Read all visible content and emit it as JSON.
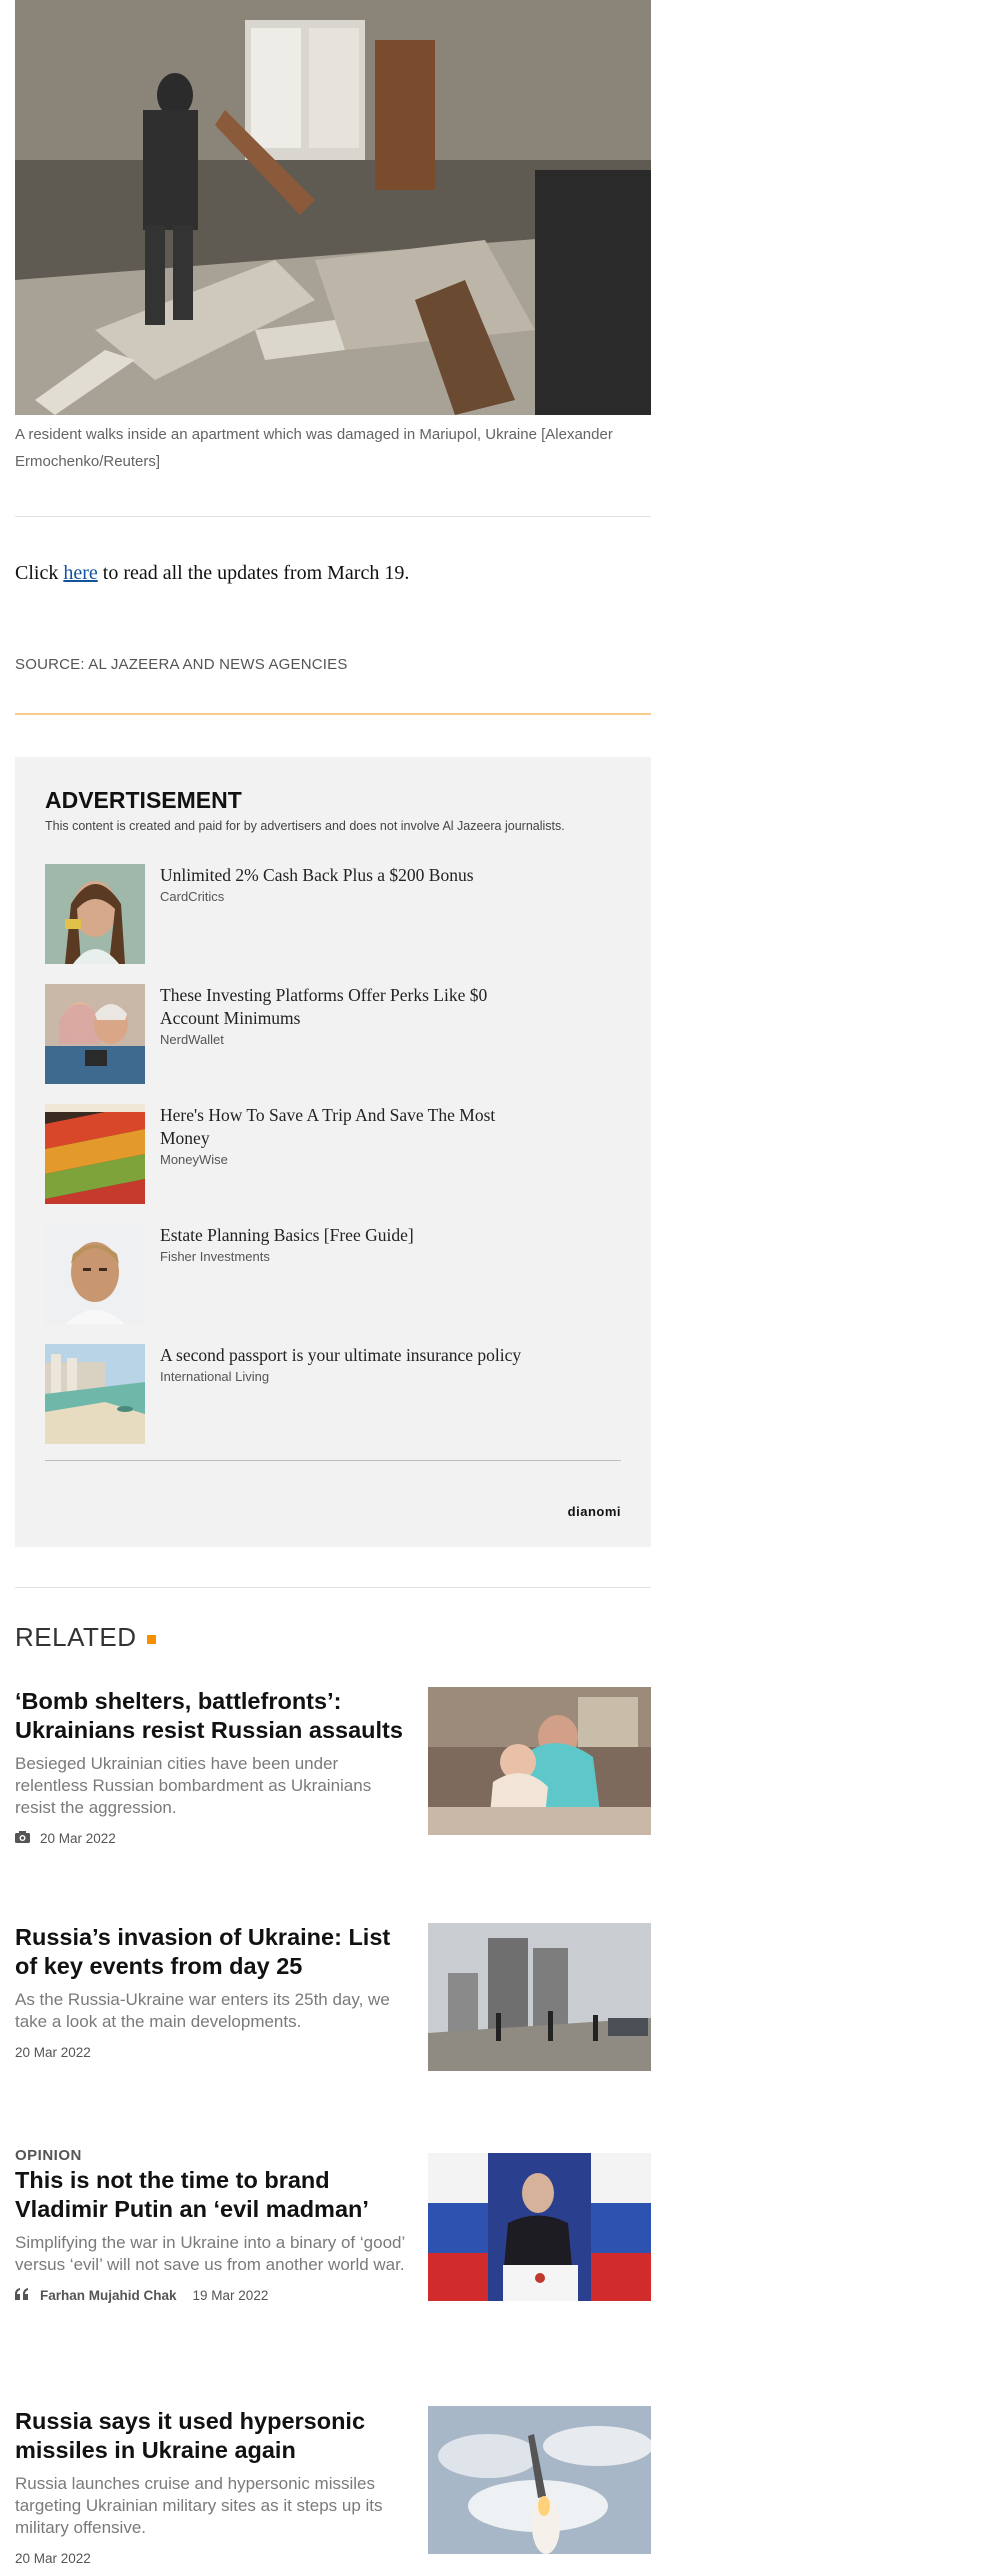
{
  "hero": {
    "image_alt": "Damaged apartment interior",
    "caption": "A resident walks inside an apartment which was damaged in Mariupol, Ukraine [Alexander Ermochenko/Reuters]"
  },
  "updates": {
    "prefix": "Click ",
    "link_text": "here",
    "suffix": " to read all the updates from March 19."
  },
  "source": "SOURCE: AL JAZEERA AND NEWS AGENCIES",
  "advertisement": {
    "title": "ADVERTISEMENT",
    "disclaimer": "This content is created and paid for by advertisers and does not involve Al Jazeera journalists.",
    "items": [
      {
        "headline": "Unlimited 2% Cash Back Plus a $200 Bonus",
        "source": "CardCritics"
      },
      {
        "headline": "These Investing Platforms Offer Perks Like $0 Account Minimums",
        "source": "NerdWallet"
      },
      {
        "headline": "Here's How To Save A Trip And Save The Most Money",
        "source": "MoneyWise"
      },
      {
        "headline": "Estate Planning Basics [Free Guide]",
        "source": "Fisher Investments"
      },
      {
        "headline": "A second passport is your ultimate insurance policy",
        "source": "International Living"
      }
    ],
    "brand": "dianomi"
  },
  "related": {
    "heading": "RELATED",
    "articles": [
      {
        "label": "",
        "title": "‘Bomb shelters, battlefronts’: Ukrainians resist Russian assaults",
        "excerpt": "Besieged Ukrainian cities have been under relentless Russian bombardment as Ukrainians resist the aggression.",
        "author": "",
        "date": "20 Mar 2022",
        "icon": "camera-icon"
      },
      {
        "label": "",
        "title": "Russia’s invasion of Ukraine: List of key events from day 25",
        "excerpt": "As the Russia-Ukraine war enters its 25th day, we take a look at the main developments.",
        "author": "",
        "date": "20 Mar 2022",
        "icon": ""
      },
      {
        "label": "OPINION",
        "title": "This is not the time to brand Vladimir Putin an ‘evil madman’",
        "excerpt": "Simplifying the war in Ukraine into a binary of ‘good’ versus ‘evil’ will not save us from another world war.",
        "author": "Farhan Mujahid Chak",
        "date": "19 Mar 2022",
        "icon": "quote-icon"
      },
      {
        "label": "",
        "title": "Russia says it used hypersonic missiles in Ukraine again",
        "excerpt": "Russia launches cruise and hypersonic missiles targeting Ukrainian military sites as it steps up its military offensive.",
        "author": "",
        "date": "20 Mar 2022",
        "icon": ""
      }
    ]
  },
  "colors": {
    "link": "#11549d",
    "accent": "#fa9000",
    "divider_orange": "#f8cb8a",
    "ad_background": "#f2f2f2"
  }
}
